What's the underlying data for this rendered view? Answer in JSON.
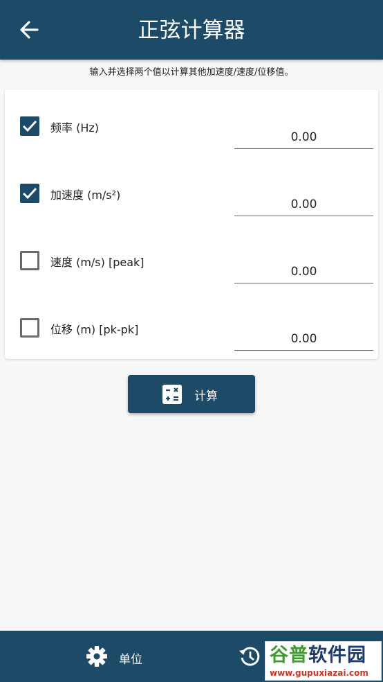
{
  "header": {
    "title": "正弦计算器",
    "back_icon": "arrow-left-icon"
  },
  "hint": "输入并选择两个值以计算其他加速度/速度/位移值。",
  "fields": [
    {
      "label": "频率 (Hz)",
      "value": "0.00",
      "checked": true
    },
    {
      "label": "加速度 (m/s²)",
      "value": "0.00",
      "checked": true
    },
    {
      "label": "速度 (m/s) [peak]",
      "value": "0.00",
      "checked": false
    },
    {
      "label": "位移 (m) [pk-pk]",
      "value": "0.00",
      "checked": false
    }
  ],
  "calculate_button": {
    "label": "计算",
    "icon": "calculator-icon"
  },
  "bottom_nav": {
    "units": {
      "label": "单位",
      "icon": "gear-icon"
    },
    "history": {
      "icon": "history-icon"
    }
  },
  "watermark": {
    "brand_a": "谷普",
    "brand_b": "软件园",
    "url": "www.gupuxiazai.com"
  },
  "colors": {
    "primary": "#1d4a66",
    "background": "#f7f7f7",
    "checkbox_off": "#6b6b6b"
  }
}
